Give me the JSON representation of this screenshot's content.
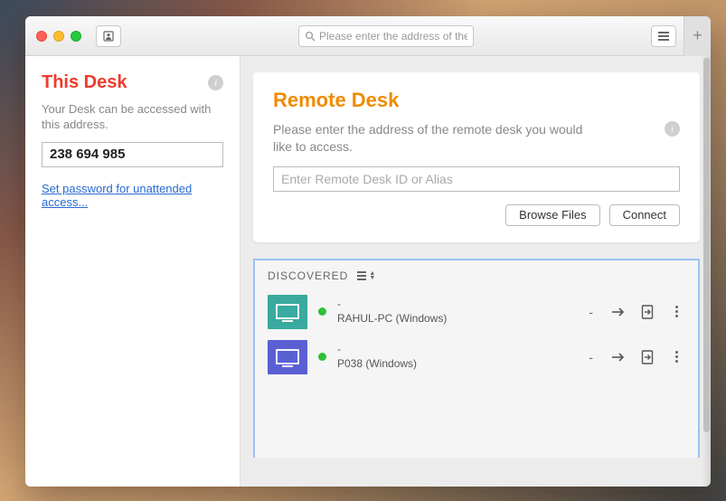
{
  "toolbar": {
    "search_placeholder": "Please enter the address of the remote desk you would like to access."
  },
  "sidebar": {
    "title": "This Desk",
    "subtitle": "Your Desk can be accessed with this address.",
    "address": "238 694 985",
    "password_link": "Set password for unattended access..."
  },
  "remote": {
    "title": "Remote Desk",
    "subtitle": "Please enter the address of the remote desk you would like to access.",
    "input_placeholder": "Enter Remote Desk ID or Alias",
    "browse_label": "Browse Files",
    "connect_label": "Connect"
  },
  "discovered": {
    "heading": "DISCOVERED",
    "items": [
      {
        "alias": "-",
        "host": "RAHUL-PC (Windows)",
        "status": "online",
        "color": "teal",
        "right_mark": "-"
      },
      {
        "alias": "-",
        "host": "P038 (Windows)",
        "status": "online",
        "color": "blue",
        "right_mark": "-"
      }
    ]
  }
}
